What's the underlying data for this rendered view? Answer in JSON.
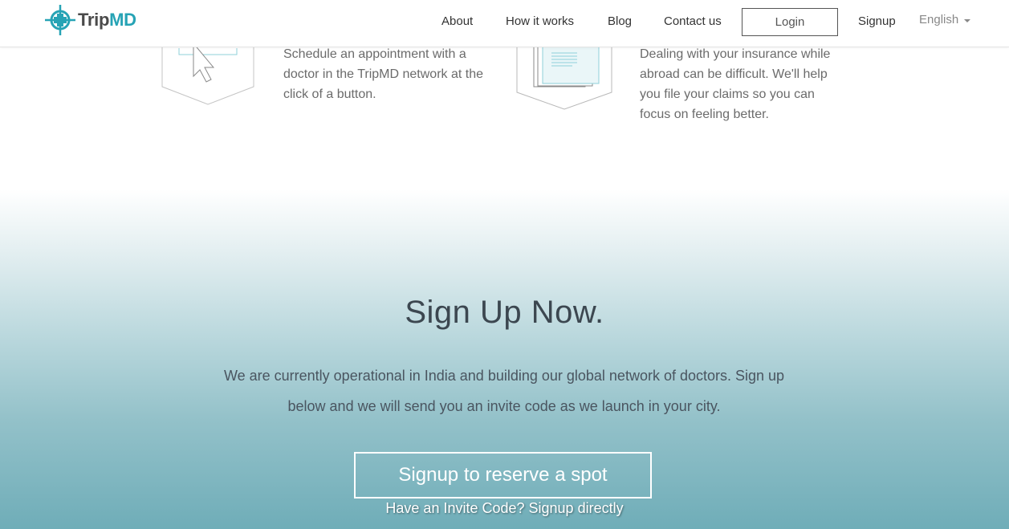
{
  "brand": {
    "name_part1": "Trip",
    "name_part2": "MD",
    "accent_color": "#26a3b5"
  },
  "nav": {
    "about": "About",
    "how_it_works": "How it works",
    "blog": "Blog",
    "contact": "Contact us",
    "login": "Login",
    "signup": "Signup",
    "language": "English"
  },
  "features": [
    {
      "icon": "cursor-click-icon",
      "text": "Schedule an appointment with a doctor in the TripMD network at the click of a button."
    },
    {
      "icon": "documents-icon",
      "text": "Dealing with your insurance while abroad can be difficult. We'll help you file your claims so you can focus on feeling better."
    }
  ],
  "signup": {
    "title": "Sign Up Now.",
    "description": "We are currently operational in India and building our global network of doctors. Sign up below and we will send you an invite code as we launch in your city.",
    "cta_label": "Signup to reserve a spot",
    "invite_link": "Have an Invite Code? Signup directly"
  }
}
